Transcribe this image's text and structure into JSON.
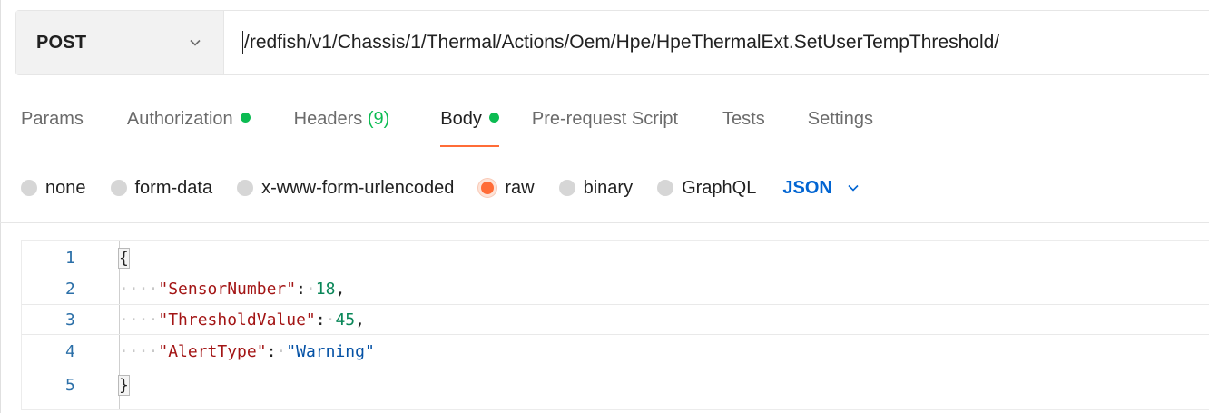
{
  "request": {
    "method": "POST",
    "url": "/redfish/v1/Chassis/1/Thermal/Actions/Oem/Hpe/HpeThermalExt.SetUserTempThreshold/"
  },
  "tabs": [
    {
      "label": "Params",
      "count": "",
      "dot": false,
      "active": false
    },
    {
      "label": "Authorization",
      "count": "",
      "dot": true,
      "active": false
    },
    {
      "label": "Headers",
      "count": "(9)",
      "dot": false,
      "active": false
    },
    {
      "label": "Body",
      "count": "",
      "dot": true,
      "active": true
    },
    {
      "label": "Pre-request Script",
      "count": "",
      "dot": false,
      "active": false
    },
    {
      "label": "Tests",
      "count": "",
      "dot": false,
      "active": false
    },
    {
      "label": "Settings",
      "count": "",
      "dot": false,
      "active": false
    }
  ],
  "body_types": {
    "options": [
      "none",
      "form-data",
      "x-www-form-urlencoded",
      "raw",
      "binary",
      "GraphQL"
    ],
    "selected": "raw",
    "language": "JSON"
  },
  "editor": {
    "lines": [
      {
        "number": "1",
        "indent": "",
        "key": "",
        "value": "",
        "value_type": "",
        "suffix": "",
        "brace": "{"
      },
      {
        "number": "2",
        "indent": "····",
        "key": "\"SensorNumber\"",
        "value": "18",
        "value_type": "num",
        "suffix": ",",
        "brace": ""
      },
      {
        "number": "3",
        "indent": "····",
        "key": "\"ThresholdValue\"",
        "value": "45",
        "value_type": "num",
        "suffix": ",",
        "brace": ""
      },
      {
        "number": "4",
        "indent": "····",
        "key": "\"AlertType\"",
        "value": "\"Warning\"",
        "value_type": "str",
        "suffix": "",
        "brace": ""
      },
      {
        "number": "5",
        "indent": "",
        "key": "",
        "value": "",
        "value_type": "",
        "suffix": "",
        "brace": "}"
      }
    ]
  },
  "colors": {
    "accent": "#ff6c37",
    "status_dot": "#0cbb52",
    "language_link": "#0265d2",
    "json_key": "#a31515",
    "json_number": "#098658",
    "json_string": "#0451a5"
  }
}
